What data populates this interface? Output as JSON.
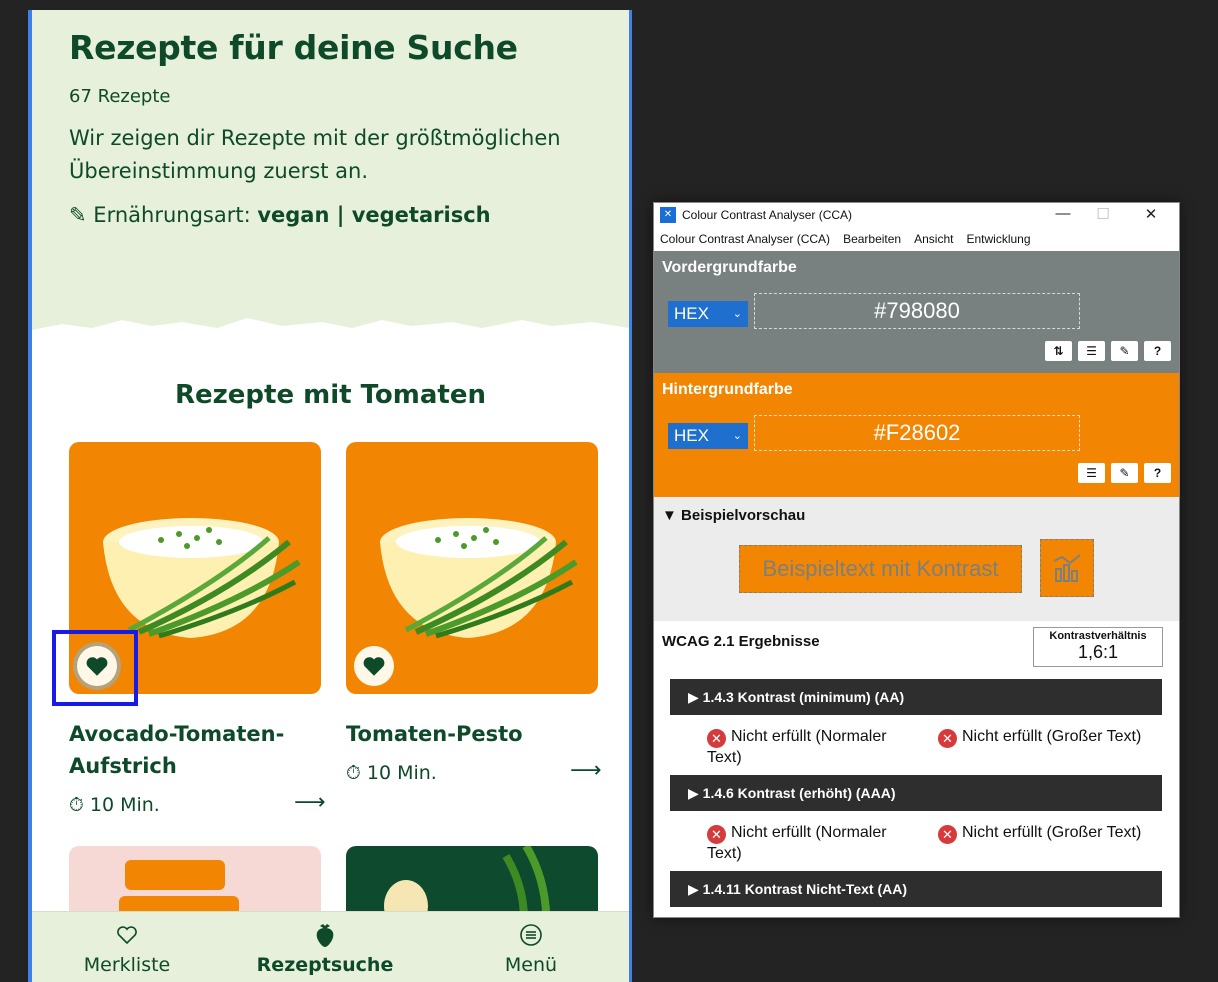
{
  "app": {
    "page_title": "Rezepte für deine Suche",
    "recipe_count": "67 Rezepte",
    "intro_text": "Wir zeigen dir Rezepte mit der größtmöglichen Übereinstimmung zuerst an.",
    "diet_label": "Ernährungsart:",
    "diet_value": "vegan | vegetarisch",
    "section_title": "Rezepte mit Tomaten",
    "recipes": [
      {
        "title": "Avocado-Tomaten-Aufstrich",
        "title_line1": "Avocado-Tomaten-",
        "title_line2": "Aufstrich",
        "time": "10 Min."
      },
      {
        "title": "Tomaten-Pesto",
        "time": "10 Min."
      }
    ],
    "bottom_nav": [
      {
        "label": "Merkliste",
        "icon": "heart-outline-icon"
      },
      {
        "label": "Rezeptsuche",
        "icon": "strawberry-icon",
        "active": true
      },
      {
        "label": "Menü",
        "icon": "menu-circle-icon"
      }
    ],
    "colors": {
      "primary_green": "#0e4a2a",
      "light_green": "#e6f0da",
      "orange": "#f28602"
    }
  },
  "cca": {
    "window_title": "Colour Contrast Analyser (CCA)",
    "menu": [
      "Colour Contrast Analyser (CCA)",
      "Bearbeiten",
      "Ansicht",
      "Entwicklung"
    ],
    "foreground": {
      "label": "Vordergrundfarbe",
      "format": "HEX",
      "value": "#798080"
    },
    "background": {
      "label": "Hintergrundfarbe",
      "format": "HEX",
      "value": "#F28602"
    },
    "preview": {
      "label": "Beispielvorschau",
      "sample_text": "Beispieltext mit Kontrast"
    },
    "results": {
      "title": "WCAG 2.1 Ergebnisse",
      "ratio_label": "Kontrastverhältnis",
      "ratio_value": "1,6:1",
      "criteria": [
        {
          "label": "1.4.3 Kontrast (minimum) (AA)",
          "normal": "Nicht erfüllt (Normaler Text)",
          "large": "Nicht erfüllt (Großer Text)"
        },
        {
          "label": "1.4.6 Kontrast (erhöht) (AAA)",
          "normal": "Nicht erfüllt (Normaler Text)",
          "large": "Nicht erfüllt (Großer Text)"
        },
        {
          "label": "1.4.11 Kontrast Nicht-Text (AA)"
        }
      ]
    }
  }
}
